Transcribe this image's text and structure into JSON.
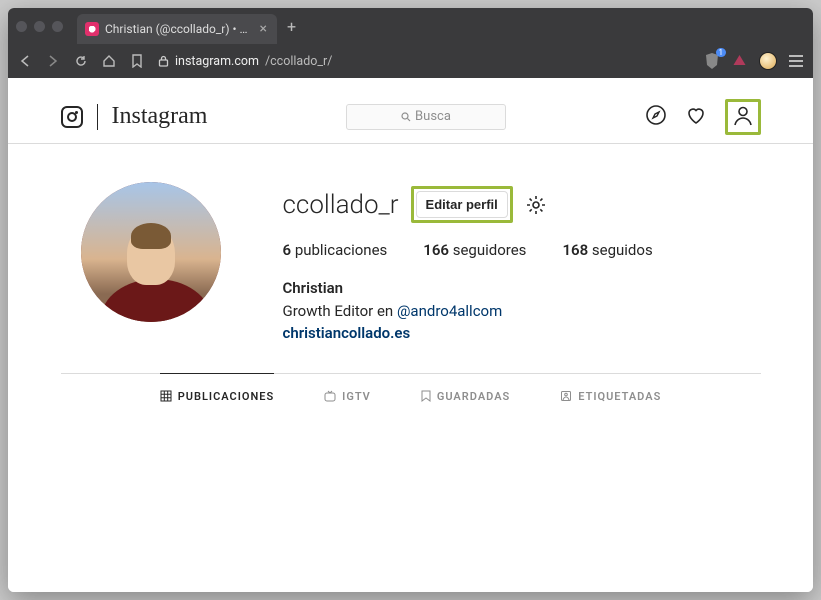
{
  "browser": {
    "tab_title": "Christian (@ccollado_r) • Fotos",
    "url_domain": "instagram.com",
    "url_path": "/ccollado_r/",
    "brave_count": "1"
  },
  "header": {
    "brand": "Instagram",
    "search_placeholder": "Busca"
  },
  "profile": {
    "username": "ccollado_r",
    "edit_label": "Editar perfil",
    "stats": {
      "posts_count": "6",
      "posts_label": "publicaciones",
      "followers_count": "166",
      "followers_label": "seguidores",
      "following_count": "168",
      "following_label": "seguidos"
    },
    "bio": {
      "name": "Christian",
      "line_prefix": "Growth Editor en ",
      "mention": "@andro4allcom",
      "link": "christiancollado.es"
    }
  },
  "tabs": {
    "posts": "Publicaciones",
    "igtv": "IGTV",
    "saved": "Guardadas",
    "tagged": "Etiquetadas"
  }
}
